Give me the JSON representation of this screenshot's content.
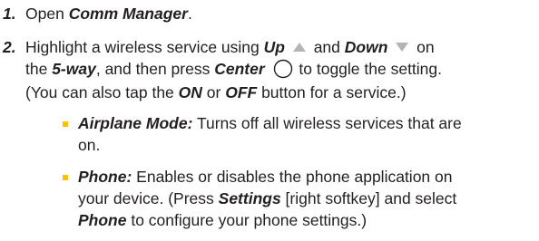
{
  "steps": [
    {
      "number": "1.",
      "pre": "Open ",
      "emph": "Comm Manager",
      "post": "."
    },
    {
      "number": "2.",
      "t1": "Highlight a wireless service using ",
      "up": "Up",
      "t2": " and ",
      "down": "Down",
      "t3": " on",
      "t4": "the ",
      "fiveway": "5-way",
      "t5": ", and then press ",
      "center": "Center",
      "t6": " to toggle the setting.",
      "t7": "(You can also tap the ",
      "on": "ON",
      "t8": " or ",
      "off": "OFF",
      "t9": " button for a service.)",
      "icons": [
        "up-triangle-icon",
        "down-triangle-icon",
        "center-circle-icon"
      ]
    }
  ],
  "bullets": [
    {
      "term": "Airplane Mode:",
      "line1": " Turns off all wireless services that are",
      "line2": "on."
    },
    {
      "term": "Phone:",
      "line1": " Enables or disables the phone application on",
      "line2a": "your device. (Press ",
      "settings": "Settings",
      "line2b": " [right softkey] and select",
      "phone": "Phone",
      "line3": " to configure your phone settings.)"
    }
  ],
  "colors": {
    "text": "#231f20",
    "bullet": "#f7c300",
    "icon": "#b4b4b4"
  }
}
